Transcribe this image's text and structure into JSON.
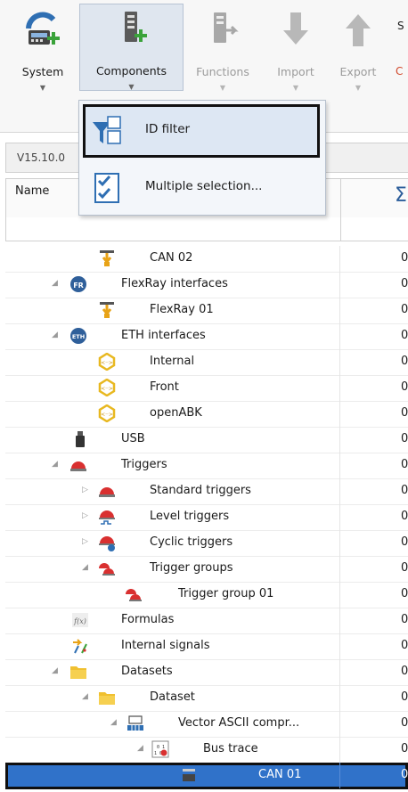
{
  "ribbon": {
    "system": "System",
    "components": "Components",
    "functions": "Functions",
    "import": "Import",
    "export": "Export",
    "cut_letter": "S",
    "cut_letter2": "C"
  },
  "dropdown": {
    "items": [
      {
        "label": "ID filter",
        "icon": "id-filter-icon"
      },
      {
        "label": "Multiple selection...",
        "icon": "multiple-selection-icon"
      }
    ]
  },
  "version": "V15.10.0",
  "columns": {
    "name": "Name",
    "sigma": "Σ"
  },
  "tree": [
    {
      "label": "CAN 02",
      "value": "0",
      "icon": "can-connector-icon"
    },
    {
      "label": "FlexRay interfaces",
      "value": "0",
      "icon": "flexray-icon"
    },
    {
      "label": "FlexRay 01",
      "value": "0",
      "icon": "can-connector-icon"
    },
    {
      "label": "ETH interfaces",
      "value": "0",
      "icon": "eth-icon"
    },
    {
      "label": "Internal",
      "value": "0",
      "icon": "eth-port-icon"
    },
    {
      "label": "Front",
      "value": "0",
      "icon": "eth-port-icon"
    },
    {
      "label": "openABK",
      "value": "0",
      "icon": "eth-port-icon"
    },
    {
      "label": "USB",
      "value": "0",
      "icon": "usb-icon"
    },
    {
      "label": "Triggers",
      "value": "0",
      "icon": "trigger-icon"
    },
    {
      "label": "Standard triggers",
      "value": "0",
      "icon": "trigger-icon"
    },
    {
      "label": "Level triggers",
      "value": "0",
      "icon": "level-trigger-icon"
    },
    {
      "label": "Cyclic triggers",
      "value": "0",
      "icon": "cyclic-trigger-icon"
    },
    {
      "label": "Trigger groups",
      "value": "0",
      "icon": "trigger-group-icon"
    },
    {
      "label": "Trigger group 01",
      "value": "0",
      "icon": "trigger-group-icon"
    },
    {
      "label": "Formulas",
      "value": "0",
      "icon": "formula-icon"
    },
    {
      "label": "Internal signals",
      "value": "0",
      "icon": "internal-signals-icon"
    },
    {
      "label": "Datasets",
      "value": "0",
      "icon": "folder-icon"
    },
    {
      "label": "Dataset",
      "value": "0",
      "icon": "folder-icon"
    },
    {
      "label": "Vector ASCII compr...",
      "value": "0",
      "icon": "vector-ascii-icon"
    },
    {
      "label": "Bus trace",
      "value": "0",
      "icon": "bus-trace-icon"
    },
    {
      "label": "CAN 01",
      "value": "0",
      "icon": "can-node-icon"
    }
  ]
}
